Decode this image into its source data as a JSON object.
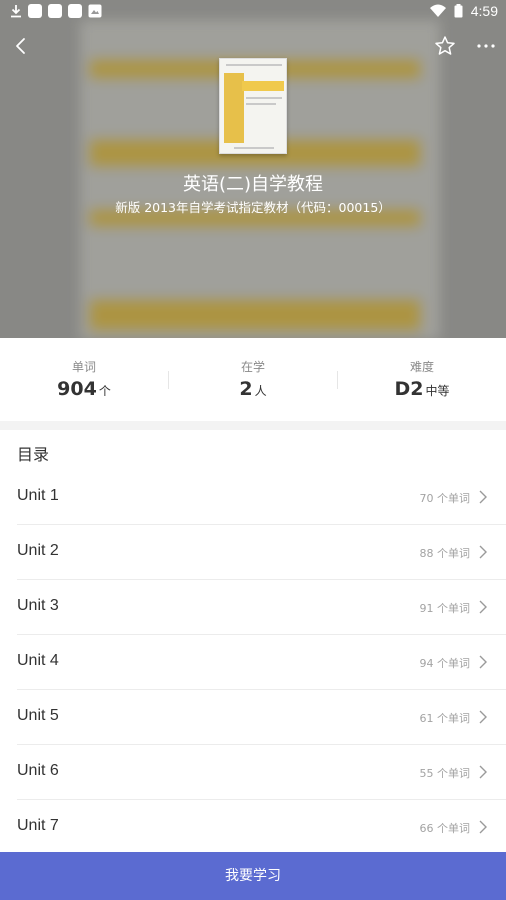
{
  "statusbar": {
    "time": "4:59"
  },
  "book": {
    "title": "英语(二)自学教程",
    "subtitle": "新版 2013年自学考试指定教材（代码：00015）"
  },
  "stats": [
    {
      "label": "单词",
      "value": "904",
      "unit": "个"
    },
    {
      "label": "在学",
      "value": "2",
      "unit": "人"
    },
    {
      "label": "难度",
      "value": "D2",
      "unit": "中等"
    }
  ],
  "catalog": {
    "title": "目录",
    "units": [
      {
        "name": "Unit 1",
        "count": "70 个单词"
      },
      {
        "name": "Unit 2",
        "count": "88 个单词"
      },
      {
        "name": "Unit 3",
        "count": "91 个单词"
      },
      {
        "name": "Unit 4",
        "count": "94 个单词"
      },
      {
        "name": "Unit 5",
        "count": "61 个单词"
      },
      {
        "name": "Unit 6",
        "count": "55 个单词"
      },
      {
        "name": "Unit 7",
        "count": "66 个单词"
      }
    ]
  },
  "cta": {
    "label": "我要学习"
  },
  "icons": {
    "back": "back-arrow-icon",
    "favorite": "star-icon",
    "more": "more-icon",
    "chevron": "chevron-right-icon"
  },
  "colors": {
    "accent": "#5b6bd1"
  }
}
